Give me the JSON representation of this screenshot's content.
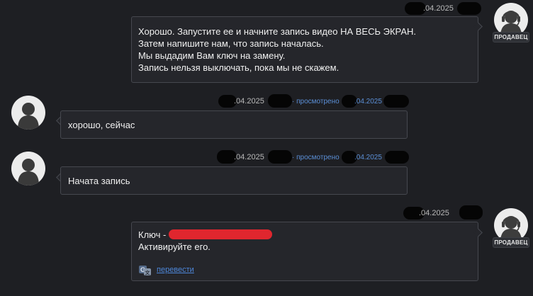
{
  "colors": {
    "background": "#1e1f23",
    "bubble": "#25262b",
    "bubble_border": "#46484f",
    "link": "#4d86d8",
    "redaction": "#e0262e"
  },
  "messages": [
    {
      "sender": "seller",
      "date": ".04.2025",
      "badge": "ПРОДАВЕЦ",
      "lines": [
        "Хорошо. Запустите ее и начните запись видео НА ВЕСЬ ЭКРАН.",
        "Затем напишите нам, что запись началась.",
        "Мы выдадим Вам ключ на замену.",
        "Запись нельзя выключать, пока мы не скажем."
      ]
    },
    {
      "sender": "buyer",
      "date": ".04.2025",
      "viewed": "· просмотрено",
      "viewed_date": ".04.2025",
      "text": "хорошо, сейчас"
    },
    {
      "sender": "buyer",
      "date": ".04.2025",
      "viewed": "· просмотрено",
      "viewed_date": ".04.2025",
      "text": "Начата запись"
    },
    {
      "sender": "seller",
      "date": ".04.2025",
      "badge": "ПРОДАВЕЦ",
      "key_label": "Ключ -",
      "text": "Активируйте его.",
      "translate_label": "перевести",
      "translate_icon": "translate-icon"
    }
  ]
}
